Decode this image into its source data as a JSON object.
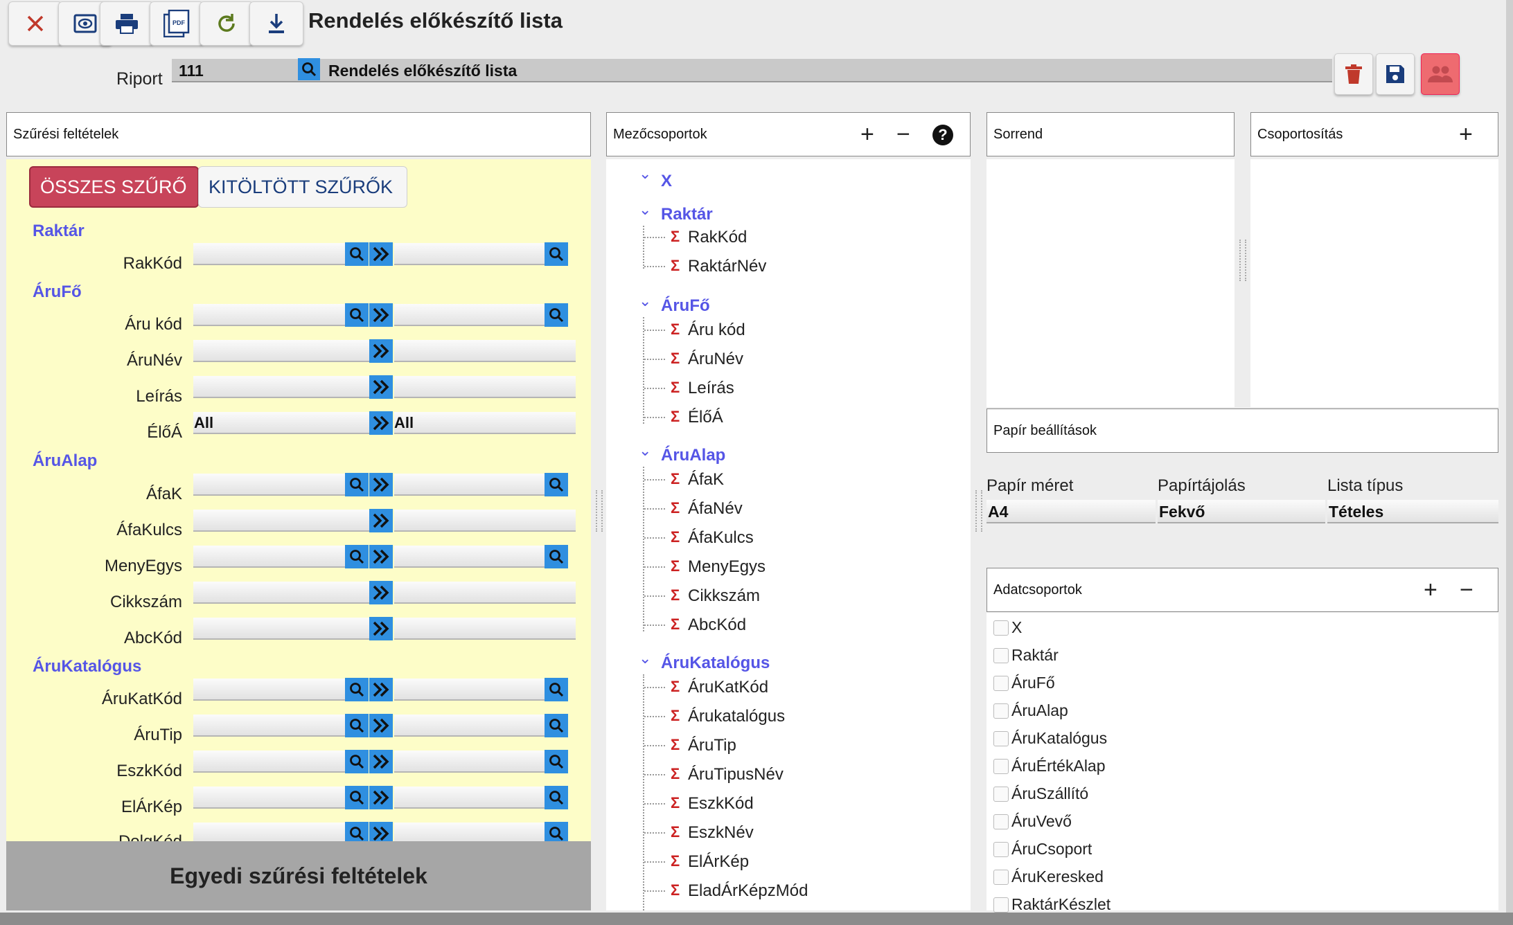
{
  "toolbar": {
    "buttons": [
      "close-icon",
      "eye-icon",
      "print-icon",
      "pdf-icon",
      "refresh-icon",
      "download-icon"
    ],
    "title": "Rendelés előkészítő lista"
  },
  "riport": {
    "label": "Riport",
    "code": "111",
    "name": "Rendelés előkészítő lista"
  },
  "filter": {
    "header": "Szűrési feltételek",
    "all_filters": "ÖSSZES SZŰRŐ",
    "filled_filters": "KITÖLTÖTT SZŰRŐK",
    "groups": [
      "Raktár",
      "ÁruFő",
      "ÁruAlap",
      "ÁruKatalógus"
    ],
    "fields": {
      "rakkod": "RakKód",
      "aru_kod": "Áru kód",
      "arunev": "ÁruNév",
      "leiras": "Leírás",
      "eloa": "ÉlőÁ",
      "afak": "ÁfaK",
      "afakulcs": "ÁfaKulcs",
      "menyegys": "MenyEgys",
      "cikkszam": "Cikkszám",
      "abckod": "AbcKód",
      "arukatkod": "ÁruKatKód",
      "arutip": "ÁruTip",
      "eszkkod": "EszkKód",
      "elarkep": "ElÁrKép",
      "dolgkod": "DolgKód"
    },
    "eloa_from": "All",
    "eloa_to": "All",
    "custom": "Egyedi szűrési feltételek"
  },
  "fieldgroups": {
    "header": "Mezőcsoportok",
    "groups": [
      {
        "name": "X",
        "items": []
      },
      {
        "name": "Raktár",
        "items": [
          "RakKód",
          "RaktárNév"
        ]
      },
      {
        "name": "ÁruFő",
        "items": [
          "Áru kód",
          "ÁruNév",
          "Leírás",
          "ÉlőÁ"
        ]
      },
      {
        "name": "ÁruAlap",
        "items": [
          "ÁfaK",
          "ÁfaNév",
          "ÁfaKulcs",
          "MenyEgys",
          "Cikkszám",
          "AbcKód"
        ]
      },
      {
        "name": "ÁruKatalógus",
        "items": [
          "ÁruKatKód",
          "Árukatalógus",
          "ÁruTip",
          "ÁruTipusNév",
          "EszkKód",
          "EszkNév",
          "ElÁrKép",
          "EladÁrKépzMód"
        ]
      }
    ]
  },
  "sorrend": {
    "header": "Sorrend"
  },
  "csoportositas": {
    "header": "Csoportosítás"
  },
  "paper": {
    "header": "Papír beállítások",
    "size_label": "Papír méret",
    "orientation_label": "Papírtájolás",
    "list_type_label": "Lista típus",
    "size": "A4",
    "orientation": "Fekvő",
    "list_type": "Tételes"
  },
  "datagroups": {
    "header": "Adatcsoportok",
    "items": [
      "X",
      "Raktár",
      "ÁruFő",
      "ÁruAlap",
      "ÁruKatalógus",
      "ÁruÉrtékAlap",
      "ÁruSzállító",
      "ÁruVevő",
      "ÁruCsoport",
      "ÁruKeresked",
      "RaktárKészlet"
    ]
  },
  "colors": {
    "accent": "#2f8fe0",
    "group_text": "#5555e6",
    "filter_bg": "#fdfdc8",
    "active_button": "#c8445a",
    "sigma": "#cc2222"
  }
}
